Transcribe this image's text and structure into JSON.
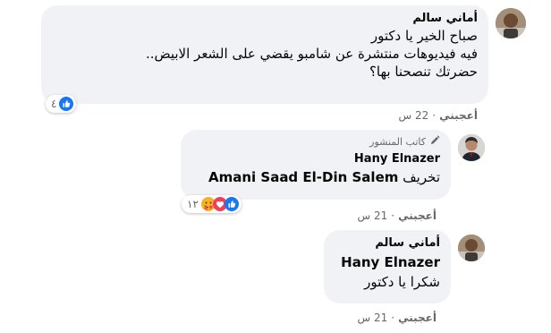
{
  "comments": [
    {
      "author": "أماني سالم",
      "lines": [
        "صباح الخير يا دكتور",
        "فيه فيديوهات منتشرة عن شامبو يقضي على الشعر الابيض..",
        "حضرتك تنصحنا بها؟"
      ],
      "reaction_count": "٤",
      "like_label": "أعجبني",
      "time": "22 س"
    },
    {
      "badge": "كاتب المنشور",
      "author": "Hany Elnazer",
      "text_arabic": "تخريف",
      "mention": "Amani Saad El-Din Salem",
      "reaction_count": "١٢",
      "like_label": "أعجبني",
      "time": "21 س"
    },
    {
      "author": "أماني سالم",
      "mention": "Hany Elnazer",
      "text": "شكرا يا دكتور",
      "like_label": "أعجبني",
      "time": "21 س"
    }
  ],
  "colors": {
    "bubble": "#f0f2f5",
    "like_blue": "#1877f2",
    "love_red": "#f33e58",
    "care_yellow": "#f7b125",
    "meta_gray": "#65676b"
  },
  "icons": [
    "like-icon",
    "love-icon",
    "care-icon",
    "pencil-icon"
  ]
}
